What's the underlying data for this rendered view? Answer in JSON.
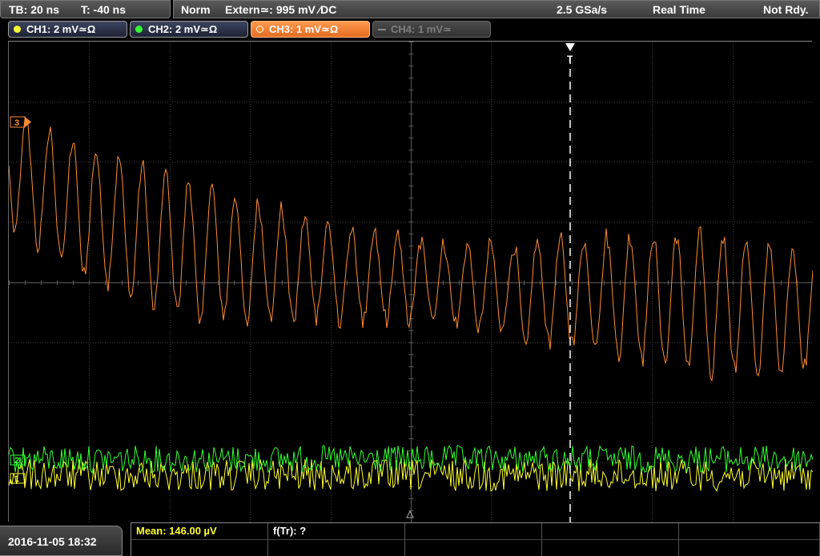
{
  "status_bar": {
    "timebase": "TB: 20 ns",
    "trigger_time": "T: -40 ns",
    "trigger_mode": "Norm",
    "trigger_source": "Extern≃: 995 mV ∕DC",
    "sample_rate": "2.5 GSa/s",
    "acquisition_mode": "Real Time",
    "state": "Not Rdy."
  },
  "channels": [
    {
      "label": "CH1: 2 mV≃Ω",
      "color": "#ffff33",
      "active": false,
      "enabled": true
    },
    {
      "label": "CH2: 2 mV≃Ω",
      "color": "#33ff33",
      "active": false,
      "enabled": true
    },
    {
      "label": "CH3: 1 mV≃Ω",
      "color": "#ff8c33",
      "active": true,
      "enabled": true
    },
    {
      "label": "CH4: 1 mV≃",
      "color": "#7d7d7d",
      "active": false,
      "enabled": false
    }
  ],
  "markers": {
    "trigger": "T",
    "ch3": "3",
    "ch2": "2",
    "ch1": "1"
  },
  "bottom": {
    "datetime": "2016-11-05 18:32",
    "measurement_1": "Mean: 146.00 µV",
    "measurement_2": "f(Tr): ?"
  },
  "colors": {
    "ch1": "#ffff33",
    "ch2": "#33ff33",
    "ch3": "#ff8c33",
    "grid": "#4a4a4a",
    "trigger_line": "#ffffff",
    "measurement_highlight": "#ffff33"
  }
}
